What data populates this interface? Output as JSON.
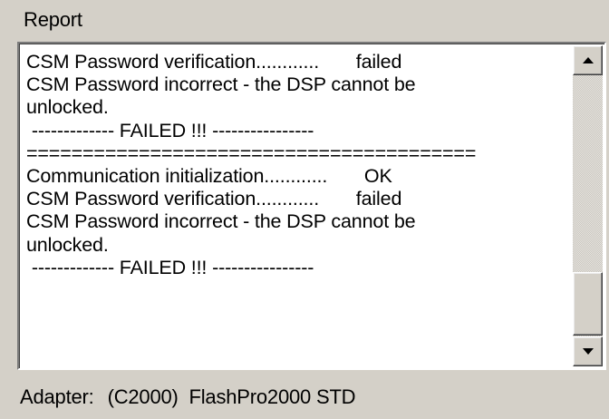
{
  "report": {
    "label": "Report",
    "lines": [
      "CSM Password verification............       failed",
      "CSM Password incorrect - the DSP cannot be",
      "unlocked.",
      " ------------- FAILED !!! ----------------",
      "========================================",
      "Communication initialization............       OK",
      "CSM Password verification............       failed",
      "CSM Password incorrect - the DSP cannot be",
      "unlocked.",
      " ------------- FAILED !!! ----------------"
    ]
  },
  "adapter": {
    "label": "Adapter:",
    "value": "(C2000)  FlashPro2000 STD"
  },
  "scrollbar": {
    "up_icon": "arrow-up-icon",
    "down_icon": "arrow-down-icon"
  }
}
